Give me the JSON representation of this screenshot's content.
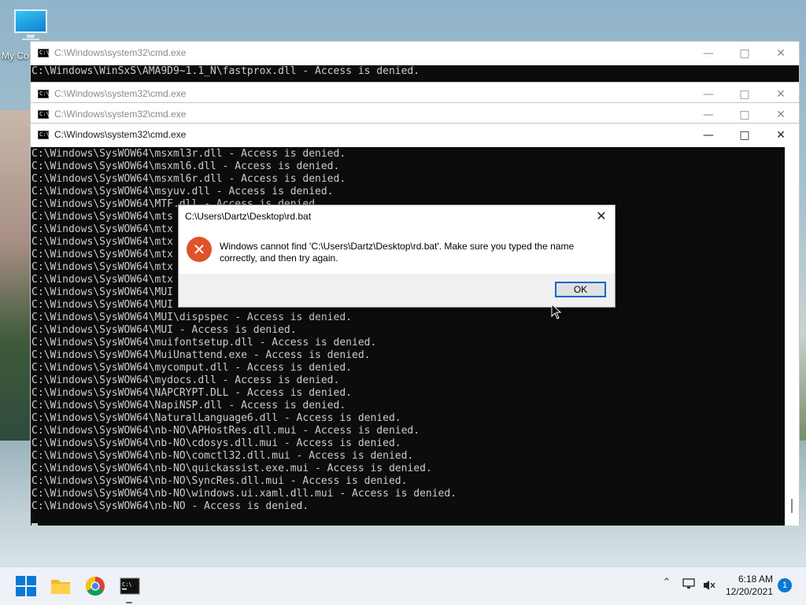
{
  "desktop": {
    "icon_label": "My Co"
  },
  "windows": [
    {
      "title": "C:\\Windows\\system32\\cmd.exe",
      "lines": [
        "C:\\Windows\\WinSxS\\AMA9D9~1.1_N\\fastprox.dll - Access is denied."
      ]
    },
    {
      "title": "C:\\Windows\\system32\\cmd.exe"
    },
    {
      "title": "C:\\Windows\\system32\\cmd.exe"
    },
    {
      "title": "C:\\Windows\\system32\\cmd.exe",
      "lines": [
        "C:\\Windows\\SysWOW64\\msxml3r.dll - Access is denied.",
        "C:\\Windows\\SysWOW64\\msxml6.dll - Access is denied.",
        "C:\\Windows\\SysWOW64\\msxml6r.dll - Access is denied.",
        "C:\\Windows\\SysWOW64\\msyuv.dll - Access is denied.",
        "C:\\Windows\\SysWOW64\\MTF.dll - Access is denied.",
        "C:\\Windows\\SysWOW64\\mts",
        "C:\\Windows\\SysWOW64\\mtx",
        "C:\\Windows\\SysWOW64\\mtx",
        "C:\\Windows\\SysWOW64\\mtx",
        "C:\\Windows\\SysWOW64\\mtx",
        "C:\\Windows\\SysWOW64\\mtx",
        "C:\\Windows\\SysWOW64\\MUI",
        "C:\\Windows\\SysWOW64\\MUI",
        "C:\\Windows\\SysWOW64\\MUI\\dispspec - Access is denied.",
        "C:\\Windows\\SysWOW64\\MUI - Access is denied.",
        "C:\\Windows\\SysWOW64\\muifontsetup.dll - Access is denied.",
        "C:\\Windows\\SysWOW64\\MuiUnattend.exe - Access is denied.",
        "C:\\Windows\\SysWOW64\\mycomput.dll - Access is denied.",
        "C:\\Windows\\SysWOW64\\mydocs.dll - Access is denied.",
        "C:\\Windows\\SysWOW64\\NAPCRYPT.DLL - Access is denied.",
        "C:\\Windows\\SysWOW64\\NapiNSP.dll - Access is denied.",
        "C:\\Windows\\SysWOW64\\NaturalLanguage6.dll - Access is denied.",
        "C:\\Windows\\SysWOW64\\nb-NO\\APHostRes.dll.mui - Access is denied.",
        "C:\\Windows\\SysWOW64\\nb-NO\\cdosys.dll.mui - Access is denied.",
        "C:\\Windows\\SysWOW64\\nb-NO\\comctl32.dll.mui - Access is denied.",
        "C:\\Windows\\SysWOW64\\nb-NO\\quickassist.exe.mui - Access is denied.",
        "C:\\Windows\\SysWOW64\\nb-NO\\SyncRes.dll.mui - Access is denied.",
        "C:\\Windows\\SysWOW64\\nb-NO\\windows.ui.xaml.dll.mui - Access is denied.",
        "C:\\Windows\\SysWOW64\\nb-NO - Access is denied."
      ]
    }
  ],
  "dialog": {
    "title": "C:\\Users\\Dartz\\Desktop\\rd.bat",
    "message": "Windows cannot find 'C:\\Users\\Dartz\\Desktop\\rd.bat'. Make sure you typed the name correctly, and then try again.",
    "ok_label": "OK"
  },
  "taskbar": {
    "time": "6:18 AM",
    "date": "12/20/2021",
    "notification_count": "1"
  },
  "colors": {
    "console_bg": "#0c0c0c",
    "console_fg": "#cccccc",
    "error_icon": "#e0532a",
    "accent": "#0a78d7"
  }
}
